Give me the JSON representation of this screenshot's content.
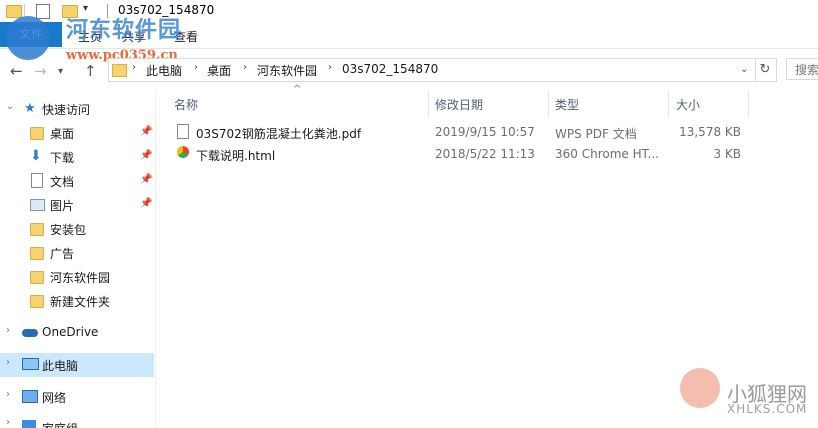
{
  "window": {
    "title": "03s702_154870"
  },
  "ribbon": {
    "file_tab": "文件",
    "tabs": [
      "主页",
      "共享",
      "查看"
    ]
  },
  "watermark": {
    "brand": "河东软件园",
    "url": "www.pc0359.cn",
    "fox_cn": "小狐狸网",
    "fox_en": "XHLKS.COM"
  },
  "address": {
    "breadcrumbs": [
      "此电脑",
      "桌面",
      "河东软件园",
      "03s702_154870"
    ],
    "search_placeholder": "搜索"
  },
  "sidebar": {
    "quick_access": "快速访问",
    "pinned": [
      {
        "label": "桌面",
        "icon": "folder-icon"
      },
      {
        "label": "下载",
        "icon": "download-icon"
      },
      {
        "label": "文档",
        "icon": "document-icon"
      },
      {
        "label": "图片",
        "icon": "picture-icon"
      }
    ],
    "folders": [
      "安装包",
      "广告",
      "河东软件园",
      "新建文件夹"
    ],
    "onedrive": "OneDrive",
    "this_pc": "此电脑",
    "network": "网络",
    "homegroup": "家庭组"
  },
  "columns": {
    "name": "名称",
    "modified": "修改日期",
    "type": "类型",
    "size": "大小"
  },
  "files": [
    {
      "name": "03S702钢筋混凝土化粪池.pdf",
      "modified": "2019/9/15 10:57",
      "type": "WPS PDF 文档",
      "size": "13,578 KB"
    },
    {
      "name": "下载说明.html",
      "modified": "2018/5/22 11:13",
      "type": "360 Chrome HT...",
      "size": "3 KB"
    }
  ]
}
